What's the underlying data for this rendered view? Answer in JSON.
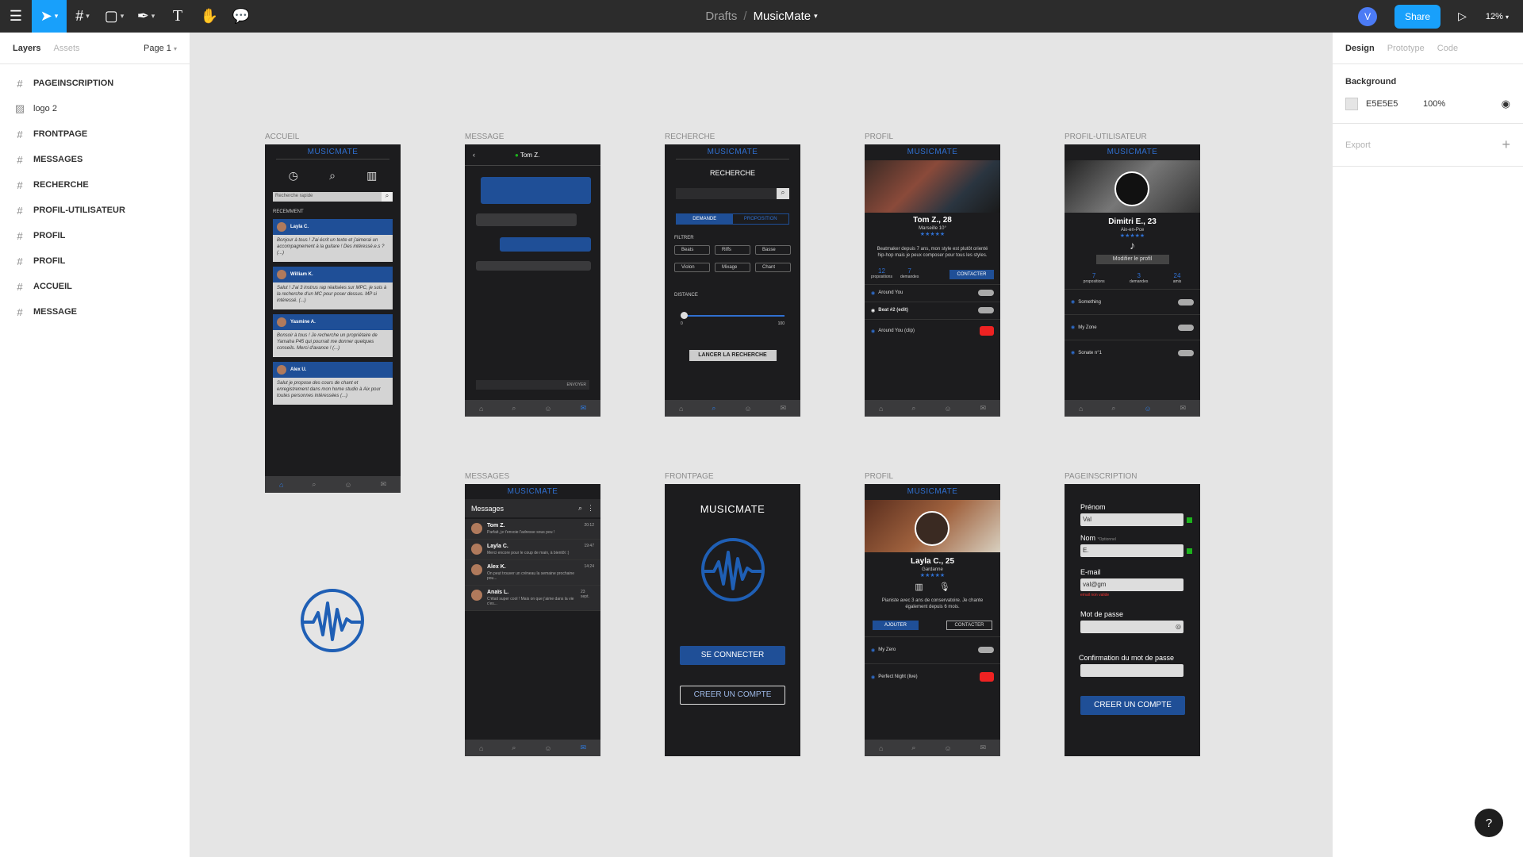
{
  "app": {
    "drafts": "Drafts",
    "separator": "/",
    "file_name": "MusicMate",
    "avatar_initial": "V",
    "share": "Share",
    "zoom": "12%"
  },
  "left_panel": {
    "tab_layers": "Layers",
    "tab_assets": "Assets",
    "page": "Page 1",
    "layers": [
      {
        "name": "PAGEINSCRIPTION",
        "icon": "frame-icon"
      },
      {
        "name": "logo 2",
        "icon": "image-icon"
      },
      {
        "name": "FRONTPAGE",
        "icon": "frame-icon"
      },
      {
        "name": "MESSAGES",
        "icon": "frame-icon"
      },
      {
        "name": "RECHERCHE",
        "icon": "frame-icon"
      },
      {
        "name": "PROFIL-UTILISATEUR",
        "icon": "frame-icon"
      },
      {
        "name": "PROFIL",
        "icon": "frame-icon"
      },
      {
        "name": "PROFIL",
        "icon": "frame-icon"
      },
      {
        "name": "ACCUEIL",
        "icon": "frame-icon"
      },
      {
        "name": "MESSAGE",
        "icon": "frame-icon"
      }
    ]
  },
  "right_panel": {
    "tab_design": "Design",
    "tab_prototype": "Prototype",
    "tab_code": "Code",
    "background_title": "Background",
    "background_hex": "E5E5E5",
    "background_opacity": "100%",
    "export_title": "Export"
  },
  "canvas": {
    "brand": "MUSICMATE",
    "labels": {
      "accueil": "ACCUEIL",
      "message": "MESSAGE",
      "recherche": "RECHERCHE",
      "profil1": "PROFIL",
      "profil_utilisateur": "PROFIL-UTILISATEUR",
      "messages": "MESSAGES",
      "frontpage": "FRONTPAGE",
      "profil2": "PROFIL",
      "pageinscription": "PAGEINSCRIPTION"
    },
    "accueil": {
      "search_placeholder": "Recherche rapide",
      "recent": "RECEMMENT",
      "cards": [
        {
          "name": "Layla C.",
          "text": "Bonjour à tous ! J'ai écrit un texte et j'aimerai un accompagnement à la guitare ! Des intéressé.e.s ? (...)"
        },
        {
          "name": "William K.",
          "text": "Salut ! J'ai 3 instrus rap réalisées sur MPC, je suis à la recherche d'un MC pour poser dessus. MP si intéressé. (...)"
        },
        {
          "name": "Yasmine A.",
          "text": "Bonsoir à tous ! Je recherche un propriétaire de Yamaha P45 qui pourrait me donner quelques conseils. Merci d'avance ! (...)"
        },
        {
          "name": "Alex U.",
          "text": "Salut je propose des cours de chant et enregistrement dans mon home studio à Aix pour toutes personnes intéressées (...)"
        }
      ]
    },
    "message": {
      "contact": "Tom Z.",
      "send": "ENVOYER"
    },
    "recherche": {
      "title": "RECHERCHE",
      "tab_demande": "DEMANDE",
      "tab_proposition": "PROPOSITION",
      "filter": "FILTRER",
      "chips": [
        "Beats",
        "Riffs",
        "Basse",
        "Violon",
        "Mixage",
        "Chant"
      ],
      "distance": "DISTANCE",
      "min": "0",
      "max": "100",
      "button": "LANCER LA RECHERCHE"
    },
    "profil1": {
      "name": "Tom Z., 28",
      "city": "Marseille 10°",
      "bio": "Beatmaker depuis 7 ans, mon style est plutôt orienté hip-hop mais je peux composer pour tous les styles.",
      "stats": [
        {
          "value": "12",
          "label": "propositions"
        },
        {
          "value": "7",
          "label": "demandes"
        }
      ],
      "contact": "CONTACTER",
      "tracks": [
        "Around You",
        "Beat #2 (edit)",
        "Around You (clip)"
      ]
    },
    "profil_utilisateur": {
      "name": "Dimitri E., 23",
      "city": "Aix-en-Pce",
      "edit": "Modifier le profil",
      "stats": [
        {
          "value": "7",
          "label": "propositions"
        },
        {
          "value": "3",
          "label": "demandes"
        },
        {
          "value": "24",
          "label": "amis"
        }
      ],
      "tracks": [
        "Something",
        "My Zone",
        "Sonate n°1"
      ]
    },
    "messages": {
      "title": "Messages",
      "items": [
        {
          "name": "Tom Z.",
          "text": "Parfait, je t'envoie l'adresse sous peu !",
          "time": "20:12"
        },
        {
          "name": "Layla C.",
          "text": "Merci encore pour le coup de main, à bientôt :)",
          "time": "19:47"
        },
        {
          "name": "Alex K.",
          "text": "On peut trouver un créneau la semaine prochaine pou...",
          "time": "14:24"
        },
        {
          "name": "Anaïs L.",
          "text": "C'était super cool ! Mais on que j'aime dans la vie c'es...",
          "time": "23 sept."
        }
      ]
    },
    "frontpage": {
      "title": "MUSICMATE",
      "login": "SE CONNECTER",
      "create": "CREER UN COMPTE"
    },
    "profil2": {
      "name": "Layla C., 25",
      "city": "Gardanne",
      "bio": "Pianiste avec 3 ans de conservatoire. Je chante également depuis 6 mois.",
      "add": "AJOUTER",
      "contact": "CONTACTER",
      "tracks": [
        "My Zero",
        "Perfect Night (live)"
      ]
    },
    "pageinscription": {
      "prenom_label": "Prénom",
      "prenom_value": "Val",
      "nom_label": "Nom",
      "nom_optional": "*Optionnel",
      "nom_value": "E.",
      "email_label": "E-mail",
      "email_value": "val@gm",
      "email_error": "email non valide",
      "password_label": "Mot de passe",
      "confirm_label": "Confirmation du mot de passe",
      "button": "CREER UN COMPTE"
    }
  }
}
